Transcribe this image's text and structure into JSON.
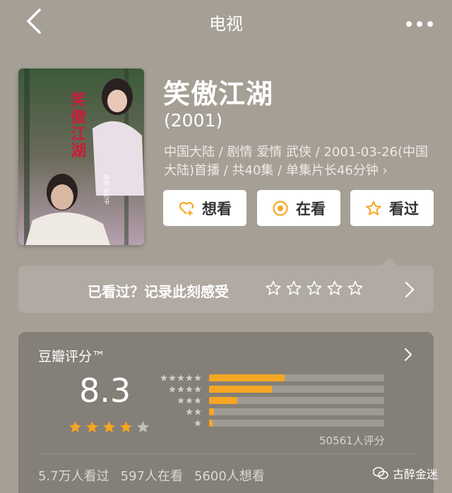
{
  "nav": {
    "title": "电视"
  },
  "show": {
    "title": "笑傲江湖",
    "year": "(2001)",
    "meta": "中国大陆 / 剧情 爱情 武侠 / 2001-03-26(中国大陆)首播 / 共40集 / 单集片长46分钟 ›"
  },
  "poster": {
    "title_chars": [
      "笑",
      "傲",
      "江",
      "湖"
    ],
    "credit_line": "监制 张纪中"
  },
  "actions": [
    {
      "label": "想看",
      "icon": "heart-plus-icon"
    },
    {
      "label": "在看",
      "icon": "target-icon"
    },
    {
      "label": "看过",
      "icon": "star-outline-icon"
    }
  ],
  "record": {
    "text": "已看过？记录此刻感受",
    "stars": 5
  },
  "rating": {
    "label": "豆瓣评分™",
    "score": "8.3",
    "score_stars": 4,
    "distribution": [
      {
        "stars": 5,
        "fraction": 0.43
      },
      {
        "stars": 4,
        "fraction": 0.36
      },
      {
        "stars": 3,
        "fraction": 0.16
      },
      {
        "stars": 2,
        "fraction": 0.03
      },
      {
        "stars": 1,
        "fraction": 0.02
      }
    ],
    "count": "50561人评分",
    "stats": [
      "5.7万人看过",
      "597人在看",
      "5600人想看"
    ]
  },
  "watermark": {
    "text": "古醉金迷"
  },
  "colors": {
    "background": "#a59f96",
    "accent": "#f5a623"
  }
}
